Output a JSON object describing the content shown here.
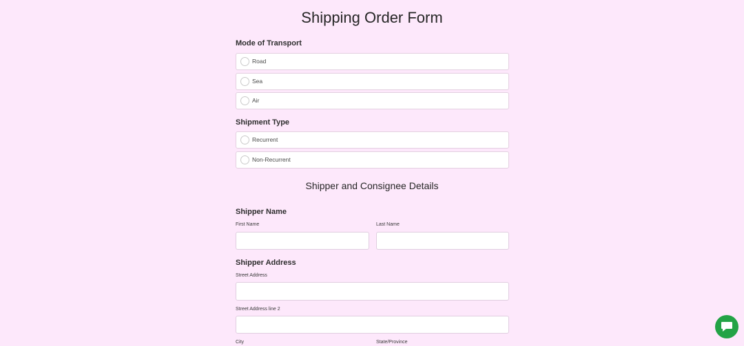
{
  "form": {
    "title": "Shipping Order Form",
    "transport": {
      "label": "Mode of Transport",
      "options": [
        "Road",
        "Sea",
        "Air"
      ]
    },
    "shipment": {
      "label": "Shipment Type",
      "options": [
        "Recurrent",
        "Non-Recurrent"
      ]
    },
    "details_heading": "Shipper and Consignee Details",
    "shipper_name": {
      "label": "Shipper Name",
      "first_label": "First Name",
      "first_value": "",
      "last_label": "Last Name",
      "last_value": ""
    },
    "shipper_address": {
      "label": "Shipper Address",
      "street_label": "Street Address",
      "street_value": "",
      "street2_label": "Street Address line 2",
      "street2_value": "",
      "city_label": "City",
      "state_label": "State/Province"
    }
  },
  "chat": {
    "icon": "chat-bubble-icon",
    "color": "#23a346"
  },
  "colors": {
    "background": "#fde8fb",
    "field_border": "#e3cfe0"
  }
}
